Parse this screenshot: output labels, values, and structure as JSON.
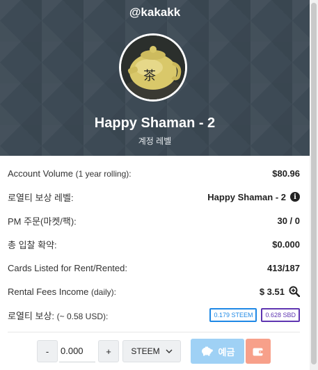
{
  "header": {
    "username": "@kakakk",
    "level_title": "Happy Shaman - 2",
    "level_subtitle": "계정 레벨"
  },
  "stats": [
    {
      "label": "Account Volume",
      "note": "(1 year rolling):",
      "value": "$80.96"
    },
    {
      "label": "로열티 보상 레벨:",
      "note": "",
      "value": "Happy Shaman - 2",
      "icon": "info-icon"
    },
    {
      "label": "PM 주문(마켓/팩):",
      "note": "",
      "value": "30 / 0"
    },
    {
      "label": "총 입찰 확약:",
      "note": "",
      "value": "$0.000"
    },
    {
      "label": "Cards Listed for Rent/Rented:",
      "note": "",
      "value": "413/187"
    },
    {
      "label": "Rental Fees Income",
      "note": "(daily):",
      "value": "$ 3.51",
      "icon": "zoom-icon"
    },
    {
      "label": "로열티 보상:",
      "note": "(~ 0.58 USD):",
      "badges": [
        "0.179 STEEM",
        "0.628 SBD"
      ]
    }
  ],
  "controls": {
    "minus": "-",
    "amount": "0.000",
    "plus": "+",
    "currency": "STEEM",
    "deposit_label": "예금"
  },
  "colors": {
    "hero_bg": "#3d4a55",
    "steem_badge": "#1e88e5",
    "sbd_badge": "#5e35b1",
    "deposit_btn": "#9fd1f5",
    "wallet_btn": "#f7a08a"
  }
}
